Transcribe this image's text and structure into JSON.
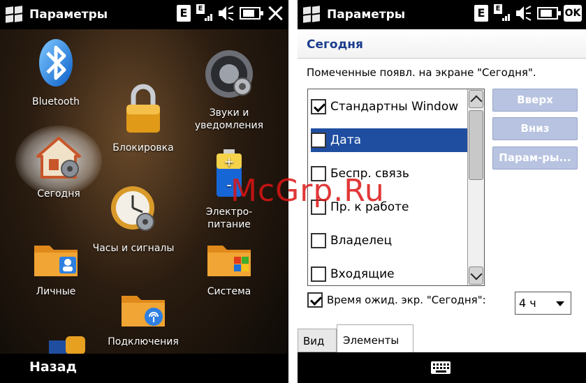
{
  "left": {
    "title": "Параметры",
    "apps": [
      {
        "label": "Bluetooth",
        "icon": "bluetooth-icon"
      },
      {
        "label": "Звуки и\nуведомления",
        "icon": "speaker-icon"
      },
      {
        "label": "Блокировка",
        "icon": "padlock-icon"
      },
      {
        "label": "Сегодня",
        "icon": "home-settings-icon"
      },
      {
        "label": "Электро-\nпитание",
        "icon": "battery-icon"
      },
      {
        "label": "Часы и сигналы",
        "icon": "clock-icon"
      },
      {
        "label": "Личные",
        "icon": "personal-folder-icon"
      },
      {
        "label": "Система",
        "icon": "system-folder-icon"
      },
      {
        "label": "Подключения",
        "icon": "connections-folder-icon"
      }
    ],
    "back_label": "Назад"
  },
  "right": {
    "title": "Параметры",
    "section": "Сегодня",
    "instruction": "Помеченные появл. на экране \"Сегодня\".",
    "items": [
      {
        "label": "Стандартны Window",
        "checked": true
      },
      {
        "label": "Дата",
        "checked": false,
        "selected": true
      },
      {
        "label": "Беспр. связь",
        "checked": false
      },
      {
        "label": "Пр. к работе",
        "checked": false
      },
      {
        "label": "Владелец",
        "checked": false
      },
      {
        "label": "Входящие",
        "checked": false
      }
    ],
    "buttons": {
      "up": "Вверх",
      "down": "Вниз",
      "params": "Парам-ры..."
    },
    "timeout_label": "Время ожид. экр. \"Сегодня\":",
    "timeout_checked": true,
    "timeout_value": "4 ч",
    "tabs": [
      "Вид",
      "Элементы"
    ],
    "active_tab": "Элементы"
  },
  "status": {
    "edge_letter": "E"
  },
  "watermark": "McGrp.Ru"
}
